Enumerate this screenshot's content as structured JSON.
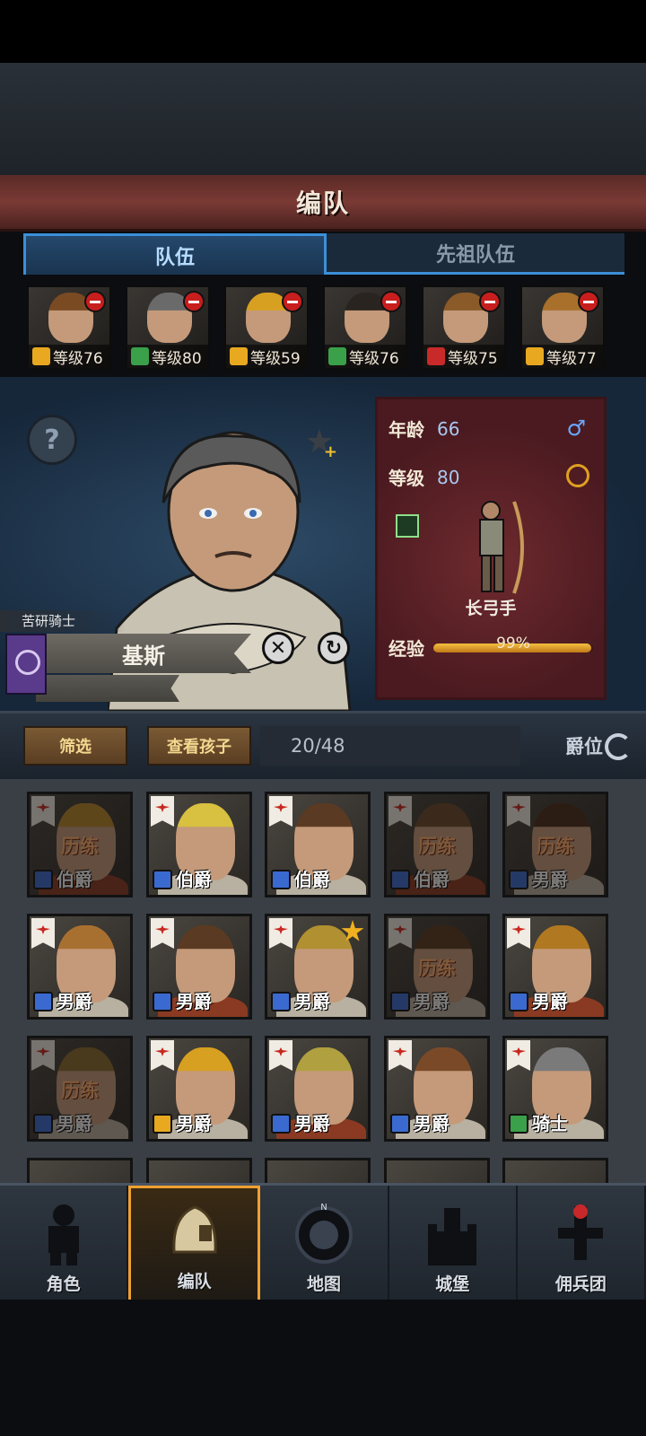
{
  "header": {
    "title": "编队"
  },
  "tabs": [
    {
      "label": "队伍",
      "active": true
    },
    {
      "label": "先祖队伍",
      "active": false
    }
  ],
  "team": [
    {
      "level_text": "等级76",
      "class": "shield",
      "hair": "#7a4a22"
    },
    {
      "level_text": "等级80",
      "class": "bow",
      "hair": "#6a6a6a"
    },
    {
      "level_text": "等级59",
      "class": "shield",
      "hair": "#d8a020"
    },
    {
      "level_text": "等级76",
      "class": "bow",
      "hair": "#2a2420"
    },
    {
      "level_text": "等级75",
      "class": "cavalry",
      "hair": "#8a5a28"
    },
    {
      "level_text": "等级77",
      "class": "shield",
      "hair": "#a8702a"
    }
  ],
  "hero": {
    "title": "苦研骑士",
    "name": "基斯",
    "info": {
      "age_label": "年龄",
      "age": "66",
      "level_label": "等级",
      "level": "80",
      "unit_name": "长弓手",
      "exp_label": "经验",
      "exp_text": "99%",
      "exp_fraction": 0.99
    }
  },
  "filter": {
    "filter_label": "筛选",
    "children_label": "查看孩子",
    "count": "20/48",
    "sort_label": "爵位"
  },
  "roster": [
    {
      "rank": "伯爵",
      "training": "历练",
      "dim": true,
      "hair": "#b8882a",
      "cls": "sword",
      "star": false
    },
    {
      "rank": "伯爵",
      "training": "",
      "dim": false,
      "hair": "#d8c040",
      "cls": "sword",
      "star": false
    },
    {
      "rank": "伯爵",
      "training": "",
      "dim": false,
      "hair": "#5a3a22",
      "cls": "sword",
      "star": false
    },
    {
      "rank": "伯爵",
      "training": "历练",
      "dim": true,
      "hair": "#6a4a2a",
      "cls": "sword",
      "star": false
    },
    {
      "rank": "男爵",
      "training": "历练",
      "dim": true,
      "hair": "#4a2e1c",
      "cls": "sword",
      "star": false
    },
    {
      "rank": "男爵",
      "training": "",
      "dim": false,
      "hair": "#a87030",
      "cls": "sword",
      "star": false
    },
    {
      "rank": "男爵",
      "training": "",
      "dim": false,
      "hair": "#5a3a22",
      "cls": "sword",
      "star": false
    },
    {
      "rank": "男爵",
      "training": "",
      "dim": false,
      "hair": "#b09030",
      "cls": "sword",
      "star": true
    },
    {
      "rank": "男爵",
      "training": "历练",
      "dim": true,
      "hair": "#5a3a22",
      "cls": "sword",
      "star": false
    },
    {
      "rank": "男爵",
      "training": "",
      "dim": false,
      "hair": "#b07820",
      "cls": "sword",
      "star": false
    },
    {
      "rank": "男爵",
      "training": "历练",
      "dim": true,
      "hair": "#8a6a30",
      "cls": "sword",
      "star": false
    },
    {
      "rank": "男爵",
      "training": "",
      "dim": false,
      "hair": "#d8a020",
      "cls": "shield",
      "star": false
    },
    {
      "rank": "男爵",
      "training": "",
      "dim": false,
      "hair": "#b0a040",
      "cls": "sword",
      "star": false
    },
    {
      "rank": "男爵",
      "training": "",
      "dim": false,
      "hair": "#7a4a28",
      "cls": "sword",
      "star": false
    },
    {
      "rank": "骑士",
      "training": "",
      "dim": false,
      "hair": "#7a7a7a",
      "cls": "bow",
      "star": false
    }
  ],
  "nav": [
    {
      "label": "角色",
      "active": false,
      "icon": "knight-icon"
    },
    {
      "label": "编队",
      "active": true,
      "icon": "helmet-icon"
    },
    {
      "label": "地图",
      "active": false,
      "icon": "compass-icon"
    },
    {
      "label": "城堡",
      "active": false,
      "icon": "castle-icon"
    },
    {
      "label": "佣兵团",
      "active": false,
      "icon": "mercenary-icon"
    }
  ],
  "colors": {
    "accent_blue": "#3b8fd8",
    "title_red": "#7a3a34",
    "panel_red": "#6e2a2e",
    "gold": "#f0a030"
  }
}
